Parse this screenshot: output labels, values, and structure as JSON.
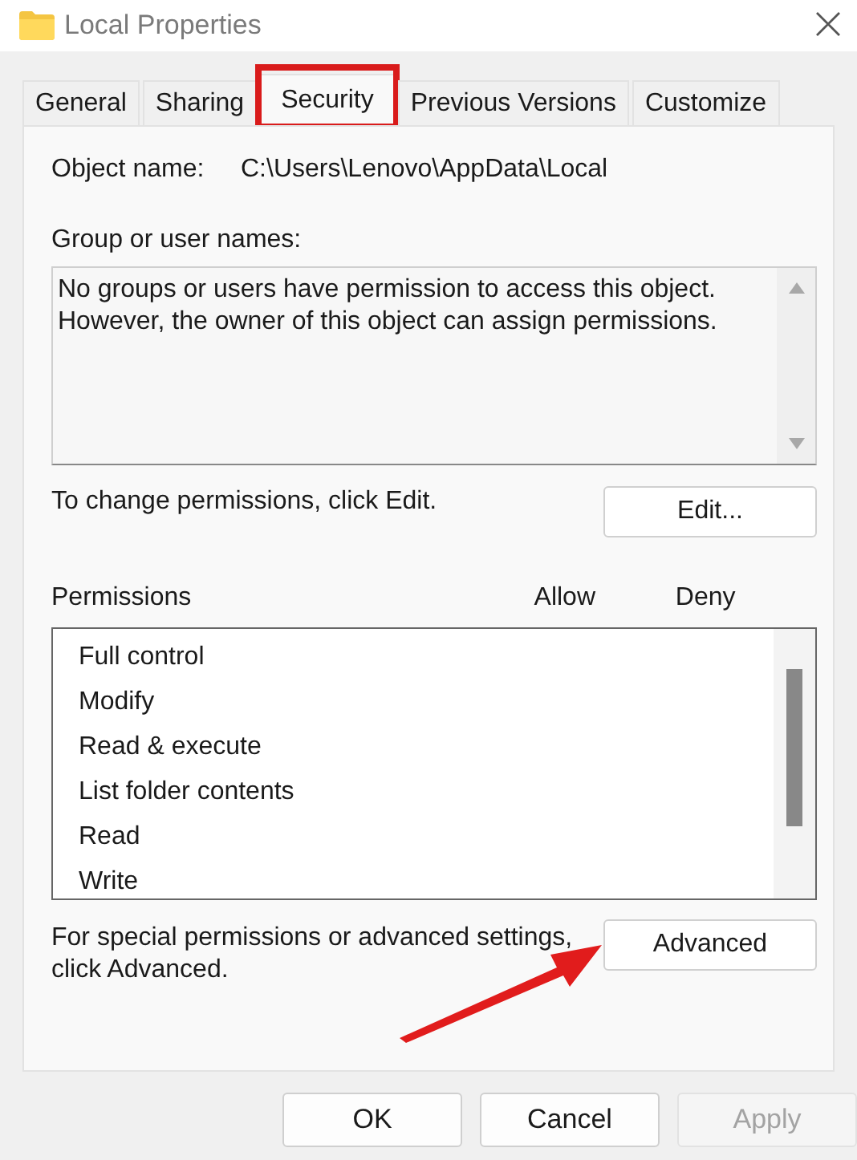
{
  "window": {
    "title": "Local Properties"
  },
  "tabs": [
    {
      "label": "General",
      "selected": false,
      "highlighted": false
    },
    {
      "label": "Sharing",
      "selected": false,
      "highlighted": false
    },
    {
      "label": "Security",
      "selected": true,
      "highlighted": true
    },
    {
      "label": "Previous Versions",
      "selected": false,
      "highlighted": false
    },
    {
      "label": "Customize",
      "selected": false,
      "highlighted": false
    }
  ],
  "object_name": {
    "label": "Object name:",
    "value": "C:\\Users\\Lenovo\\AppData\\Local"
  },
  "group_names": {
    "label": "Group or user names:",
    "message": [
      "No groups or users have permission to access this object.",
      "However, the owner of this object can assign permissions."
    ]
  },
  "edit_hint": "To change permissions, click Edit.",
  "edit_button": "Edit...",
  "permissions": {
    "label": "Permissions",
    "columns": [
      "Allow",
      "Deny"
    ],
    "rows": [
      "Full control",
      "Modify",
      "Read & execute",
      "List folder contents",
      "Read",
      "Write"
    ]
  },
  "advanced_hint": "For special permissions or advanced settings, click Advanced.",
  "advanced_button": "Advanced",
  "annotations": [
    {
      "kind": "arrow"
    }
  ],
  "buttons": [
    {
      "label": "OK",
      "disabled": false
    },
    {
      "label": "Cancel",
      "disabled": false
    },
    {
      "label": "Apply",
      "disabled": true
    }
  ]
}
